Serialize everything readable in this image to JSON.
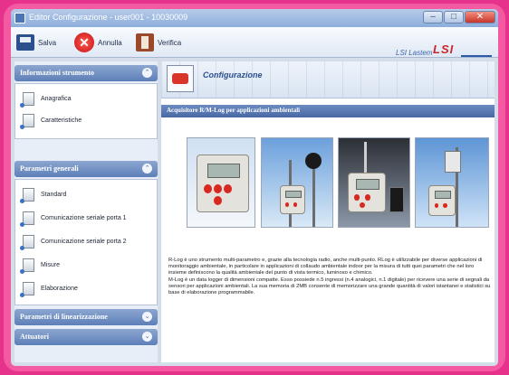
{
  "window": {
    "title": "Editor Configurazione - user001 - 10030009"
  },
  "toolbar": {
    "save_label": "Salva",
    "cancel_label": "Annulla",
    "verify_label": "Verifica",
    "brand_text": "LSI Lastem",
    "logo_text": "LSI"
  },
  "sidebar": {
    "sections": [
      {
        "title": "Informazioni strumento",
        "items": [
          "Anagrafica",
          "Caratteristiche"
        ]
      },
      {
        "title": "Parametri generali",
        "items": [
          "Standard",
          "Comunicazione seriale porta 1",
          "Comunicazione seriale porta 2",
          "Misure",
          "Elaborazione"
        ]
      },
      {
        "title": "Parametri di linearizzazione",
        "items": []
      },
      {
        "title": "Attuatori",
        "items": []
      }
    ]
  },
  "content": {
    "title": "Configurazione",
    "subtitle": "Acquisitore R/M-Log per applicazioni ambientali",
    "paragraph1": "R-Log è uno strumento multi-parametro e, grazie alla tecnologia radio, anche multi-punto. RLog è utilizzabile per diverse applicazioni di monitoraggio ambientale, in particolare in applicazioni di collaudo ambientale indoor per la misura di tutti quei parametri che nel loro insieme definiscono la qualità ambientale del punto di vista termico, luminoso e chimico.",
    "paragraph2": "M-Log è un data logger di dimensioni compatte. Esso possiede n.5 ingressi (n.4 analogici, n.1 digitale) per ricevere una serie di segnali da sensori per applicazioni ambientali. La sua memoria di 2MB consente di memorizzare una grande quantità di valori istantanei e statistici su base di elaborazione programmabile."
  },
  "colors": {
    "frame": "#e7328b",
    "titlebar": "#8caedc",
    "section_header": "#5d7fb8",
    "accent_red": "#d8281f"
  }
}
